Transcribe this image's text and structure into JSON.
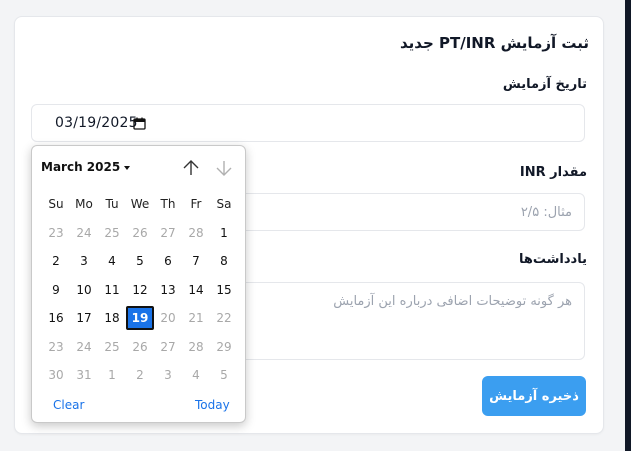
{
  "form": {
    "title": "ثبت آزمایش PT/INR جدید",
    "date_label": "تاریخ آزمایش",
    "date_value": "03/19/2025",
    "inr_label": "مقدار INR",
    "inr_placeholder": "مثال: ۲/۵",
    "notes_label": "یادداشت‌ها",
    "notes_placeholder": "هر گونه توضیحات اضافی درباره این آزمایش",
    "save_label": "ذخیره آزمایش"
  },
  "picker": {
    "month_label": "March 2025",
    "weekdays": [
      "Su",
      "Mo",
      "Tu",
      "We",
      "Th",
      "Fr",
      "Sa"
    ],
    "weeks": [
      [
        {
          "d": "23",
          "m": true
        },
        {
          "d": "24",
          "m": true
        },
        {
          "d": "25",
          "m": true
        },
        {
          "d": "26",
          "m": true
        },
        {
          "d": "27",
          "m": true
        },
        {
          "d": "28",
          "m": true
        },
        {
          "d": "1",
          "m": false
        }
      ],
      [
        {
          "d": "2",
          "m": false
        },
        {
          "d": "3",
          "m": false
        },
        {
          "d": "4",
          "m": false
        },
        {
          "d": "5",
          "m": false
        },
        {
          "d": "6",
          "m": false
        },
        {
          "d": "7",
          "m": false
        },
        {
          "d": "8",
          "m": false
        }
      ],
      [
        {
          "d": "9",
          "m": false
        },
        {
          "d": "10",
          "m": false
        },
        {
          "d": "11",
          "m": false
        },
        {
          "d": "12",
          "m": false
        },
        {
          "d": "13",
          "m": false
        },
        {
          "d": "14",
          "m": false
        },
        {
          "d": "15",
          "m": false
        }
      ],
      [
        {
          "d": "16",
          "m": false
        },
        {
          "d": "17",
          "m": false
        },
        {
          "d": "18",
          "m": false
        },
        {
          "d": "19",
          "m": false,
          "sel": true
        },
        {
          "d": "20",
          "m": true
        },
        {
          "d": "21",
          "m": true
        },
        {
          "d": "22",
          "m": true
        }
      ],
      [
        {
          "d": "23",
          "m": true
        },
        {
          "d": "24",
          "m": true
        },
        {
          "d": "25",
          "m": true
        },
        {
          "d": "26",
          "m": true
        },
        {
          "d": "27",
          "m": true
        },
        {
          "d": "28",
          "m": true
        },
        {
          "d": "29",
          "m": true
        }
      ],
      [
        {
          "d": "30",
          "m": true
        },
        {
          "d": "31",
          "m": true
        },
        {
          "d": "1",
          "m": true
        },
        {
          "d": "2",
          "m": true
        },
        {
          "d": "3",
          "m": true
        },
        {
          "d": "4",
          "m": true
        },
        {
          "d": "5",
          "m": true
        }
      ]
    ],
    "clear_label": "Clear",
    "today_label": "Today"
  },
  "colors": {
    "save_button": "#3b9ef0",
    "selected_day": "#1a73e8",
    "link": "#1a73e8"
  }
}
